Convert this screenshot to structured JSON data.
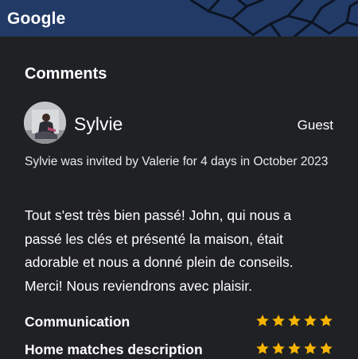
{
  "header": {
    "logo": "Google"
  },
  "comments": {
    "title": "Comments",
    "review": {
      "avatar_icon": "user-photo",
      "name": "Sylvie",
      "role": "Guest",
      "invite_text": "Sylvie was invited by Valerie for 4 days in October 2023",
      "comment": "Tout s'est très bien passé! John, qui nous a passé les clés et présenté la maison, était adorable et nous a donné plein de conseils. Merci! Nous reviendrons avec plaisir."
    },
    "ratings": [
      {
        "label": "Communication",
        "stars": 5
      },
      {
        "label": "Home matches description",
        "stars": 5
      }
    ]
  },
  "colors": {
    "background": "#202124",
    "map": "#223a66",
    "star": "#f5b400"
  }
}
